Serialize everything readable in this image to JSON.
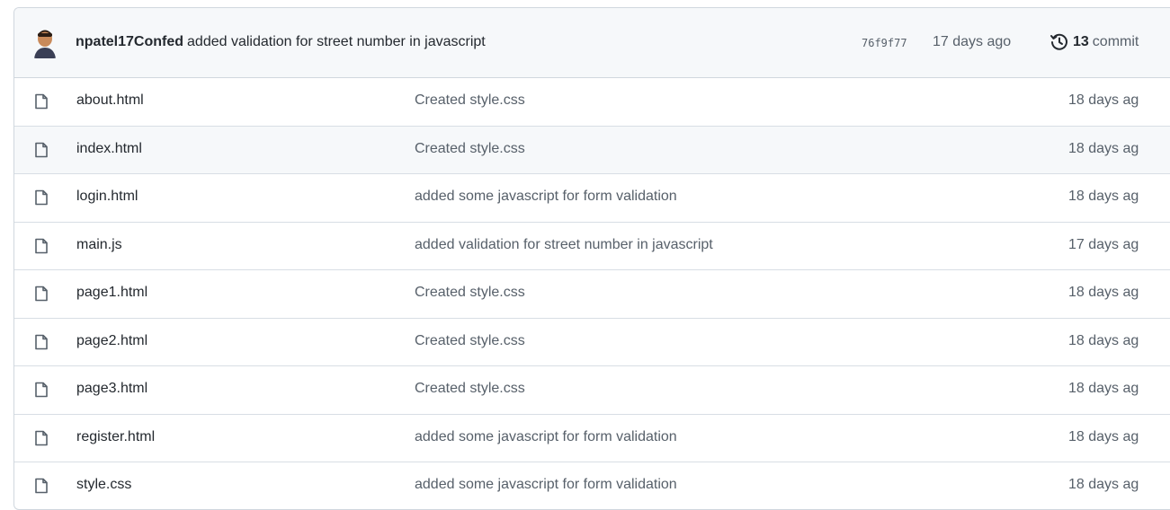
{
  "commit": {
    "author": "npatel17Confed",
    "message": "added validation for street number in javascript",
    "sha": "76f9f77",
    "date": "17 days ago",
    "count": "13",
    "count_label": "commit"
  },
  "files": [
    {
      "name": "about.html",
      "message": "Created style.css",
      "age": "18 days ag"
    },
    {
      "name": "index.html",
      "message": "Created style.css",
      "age": "18 days ag"
    },
    {
      "name": "login.html",
      "message": "added some javascript for form validation",
      "age": "18 days ag"
    },
    {
      "name": "main.js",
      "message": "added validation for street number in javascript",
      "age": "17 days ag"
    },
    {
      "name": "page1.html",
      "message": "Created style.css",
      "age": "18 days ag"
    },
    {
      "name": "page2.html",
      "message": "Created style.css",
      "age": "18 days ag"
    },
    {
      "name": "page3.html",
      "message": "Created style.css",
      "age": "18 days ag"
    },
    {
      "name": "register.html",
      "message": "added some javascript for form validation",
      "age": "18 days ag"
    },
    {
      "name": "style.css",
      "message": "added some javascript for form validation",
      "age": "18 days ag"
    }
  ],
  "icons": {
    "file": "file-icon",
    "history": "history-icon",
    "avatar": "avatar"
  },
  "colors": {
    "header_bg": "#f6f8fa",
    "hover_row_bg": "#f6f8fa",
    "border": "#d0d7de",
    "muted_text": "#57606a",
    "text": "#24292f"
  }
}
